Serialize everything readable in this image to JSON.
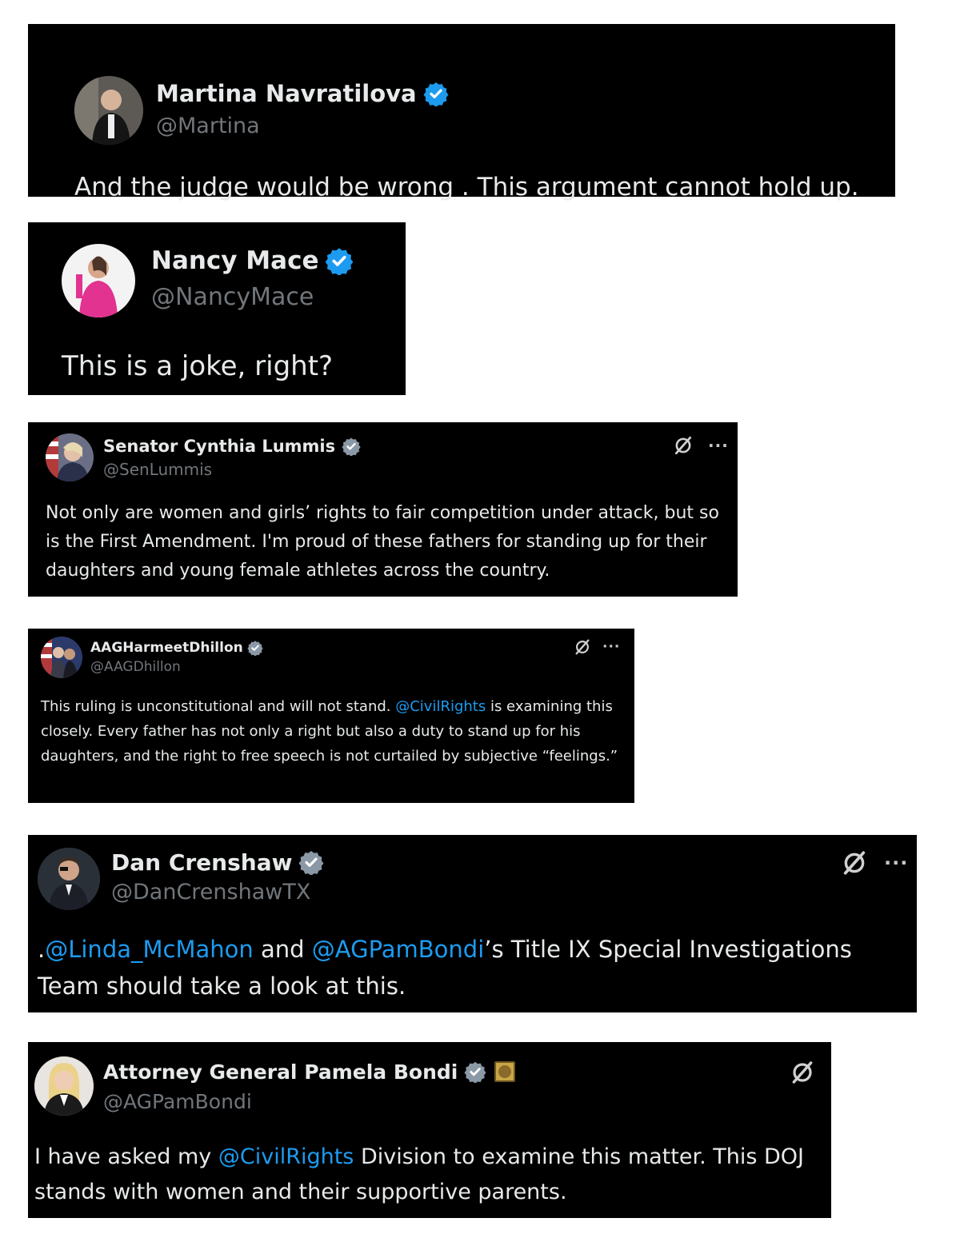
{
  "colors": {
    "background": "#000000",
    "text": "#e7e9ea",
    "handle": "#71767b",
    "mention": "#1d9bf0",
    "verified": "#1d9bf0"
  },
  "tweets": [
    {
      "name": "Martina Navratilova",
      "handle": "@Martina",
      "text": [
        {
          "t": "And the judge would be wrong . This argument cannot hold up."
        }
      ],
      "avatar_icon": "avatar-photo",
      "verified": true,
      "actions": []
    },
    {
      "name": "Nancy Mace",
      "handle": "@NancyMace",
      "text": [
        {
          "t": "This is a joke, right?"
        }
      ],
      "avatar_icon": "avatar-photo",
      "verified": true,
      "actions": []
    },
    {
      "name": "Senator Cynthia Lummis",
      "handle": "@SenLummis",
      "text": [
        {
          "t": "Not only are women and girls’ rights to fair competition under attack, but so is the First Amendment. I'm proud of these fathers for standing up for their daughters and young female athletes across the country."
        }
      ],
      "avatar_icon": "avatar-photo",
      "verified": true,
      "actions": [
        "grok-icon",
        "more-icon"
      ]
    },
    {
      "name": "AAGHarmeetDhillon",
      "handle": "@AAGDhillon",
      "text": [
        {
          "t": "This ruling is unconstitutional and will not stand. "
        },
        {
          "t": "@CivilRights",
          "mention": true
        },
        {
          "t": " is examining this closely. Every father has not only a right but also a duty to stand up for his daughters, and the right to free speech is not curtailed by subjective “feelings.”"
        }
      ],
      "avatar_icon": "avatar-photo",
      "verified": true,
      "actions": [
        "grok-icon",
        "more-icon"
      ]
    },
    {
      "name": "Dan Crenshaw",
      "handle": "@DanCrenshawTX",
      "text": [
        {
          "t": "."
        },
        {
          "t": "@Linda_McMahon",
          "mention": true
        },
        {
          "t": " and "
        },
        {
          "t": "@AGPamBondi",
          "mention": true
        },
        {
          "t": "’s Title IX Special Investigations Team should take a look at this."
        }
      ],
      "avatar_icon": "avatar-photo",
      "verified": true,
      "actions": [
        "grok-icon",
        "more-icon"
      ]
    },
    {
      "name": "Attorney General Pamela Bondi",
      "handle": "@AGPamBondi",
      "text": [
        {
          "t": "I have asked my "
        },
        {
          "t": "@CivilRights",
          "mention": true
        },
        {
          "t": " Division to examine this matter. This DOJ stands with women and their supportive parents."
        }
      ],
      "avatar_icon": "avatar-photo",
      "verified": true,
      "seal_icon": "doj-seal-icon",
      "actions": [
        "grok-icon"
      ]
    }
  ]
}
